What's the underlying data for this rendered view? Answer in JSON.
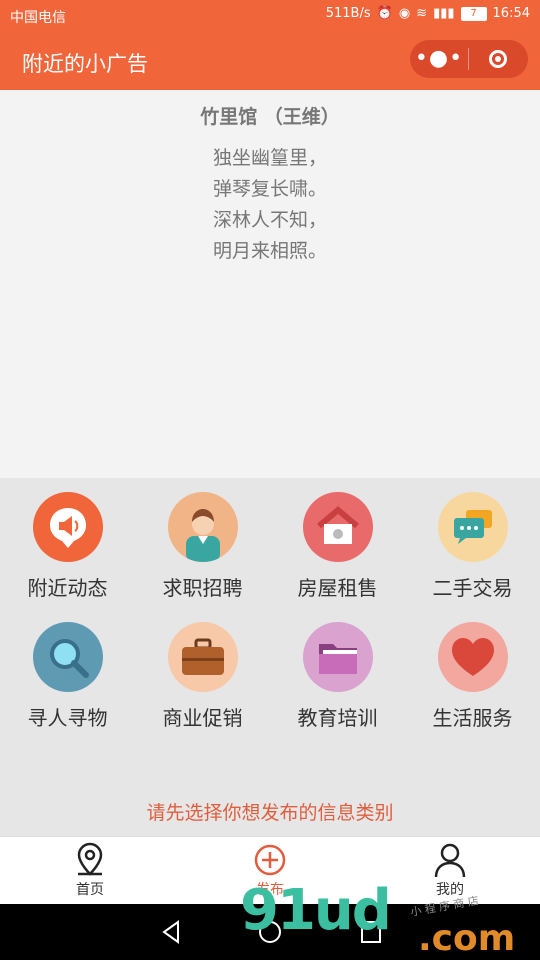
{
  "status_bar": {
    "carrier": "中国电信",
    "speed": "511B/s",
    "battery": "7",
    "time": "16:54"
  },
  "nav": {
    "title": "附近的小广告",
    "more_icon": "more-dots-icon",
    "close_icon": "target-close-icon"
  },
  "poem": {
    "title": "竹里馆 （王维）",
    "lines": [
      "独坐幽篁里，",
      "弹琴复长啸。",
      "深林人不知，",
      "明月来相照。"
    ]
  },
  "categories": [
    {
      "label": "附近动态",
      "icon": "megaphone-icon",
      "color": "#f0653a"
    },
    {
      "label": "求职招聘",
      "icon": "person-icon",
      "color": "#f1b487"
    },
    {
      "label": "房屋租售",
      "icon": "house-icon",
      "color": "#e86a6a"
    },
    {
      "label": "二手交易",
      "icon": "chat-bubbles-icon",
      "color": "#f7d79e"
    },
    {
      "label": "寻人寻物",
      "icon": "magnifier-icon",
      "color": "#5f9ab3"
    },
    {
      "label": "商业促销",
      "icon": "briefcase-icon",
      "color": "#f7c9a9"
    },
    {
      "label": "教育培训",
      "icon": "folder-icon",
      "color": "#d9a2cf"
    },
    {
      "label": "生活服务",
      "icon": "heart-icon",
      "color": "#f2a79f"
    }
  ],
  "hint": "请先选择你想发布的信息类别",
  "tabs": [
    {
      "label": "首页",
      "icon": "location-pin-icon"
    },
    {
      "label": "发布",
      "icon": "plus-circle-icon",
      "color": "#e05e3e"
    },
    {
      "label": "我的",
      "icon": "user-icon"
    }
  ],
  "watermark": {
    "text": "91ud",
    "suffix": ".com",
    "small": "小 程 序 商 店"
  }
}
